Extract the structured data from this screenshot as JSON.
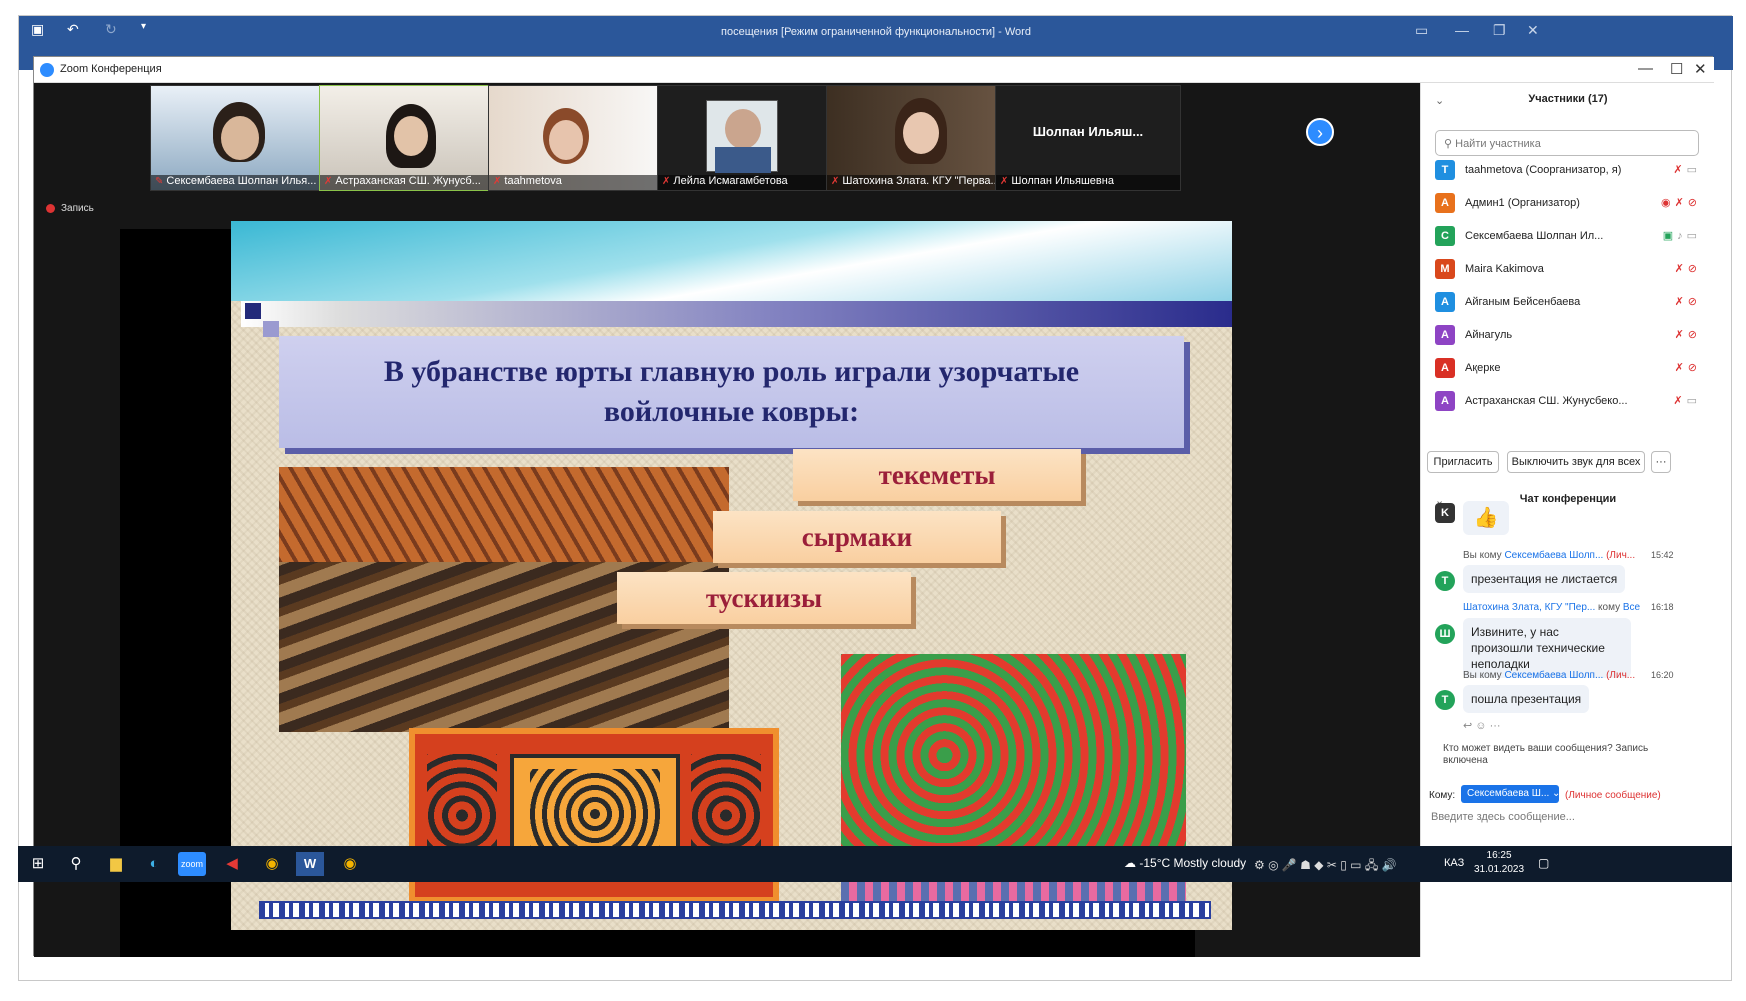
{
  "word": {
    "title": "посещения [Режим ограниченной функциональности] - Word"
  },
  "zoom": {
    "window_title": "Zoom Конференция",
    "recording": "Запись"
  },
  "video_tiles": [
    {
      "name": "Сексембаева Шолпан Илья...",
      "bg": "#8aa7c0"
    },
    {
      "name": "Астраханская СШ. Жунусб...",
      "bg": "#c9c2b8"
    },
    {
      "name": "taahmetova",
      "bg": "#d8cfc6"
    },
    {
      "name": "Лейла Исмагамбетова",
      "bg": "#2a2a2a"
    },
    {
      "name": "Шатохина Злата. КГУ \"Перва...",
      "bg": "#5a4a3a"
    },
    {
      "name": "Шолпан Ильяшевна",
      "bg": "#1e1e1e",
      "label": "Шолпан  Ильяш..."
    }
  ],
  "slide": {
    "heading": "В убранстве юрты главную роль играли узорчатые войлочные ковры:",
    "labels": [
      "текеметы",
      "сырмаки",
      "тускиизы"
    ]
  },
  "participants": {
    "title": "Участники (17)",
    "search_placeholder": "Найти участника",
    "list": [
      {
        "initial": "T",
        "name": "taahmetova (Соорганизатор, я)",
        "color": "#1f8fe0"
      },
      {
        "initial": "А",
        "name": "Админ1 (Организатор)",
        "color": "#e8711c"
      },
      {
        "initial": "С",
        "name": "Сексембаева Шолпан Ил...",
        "color": "#23a35a"
      },
      {
        "initial": "M",
        "name": "Maira Kakimova",
        "color": "#d9481c"
      },
      {
        "initial": "А",
        "name": "Айганым Бейсенбаева",
        "color": "#1f8fe0"
      },
      {
        "initial": "А",
        "name": "Айнагуль",
        "color": "#8e44c4"
      },
      {
        "initial": "А",
        "name": "Ақерке",
        "color": "#d93025"
      },
      {
        "initial": "А",
        "name": "Астраханская СШ. Жунусбеко...",
        "color": "#8e44c4"
      }
    ],
    "invite": "Пригласить",
    "mute_all": "Выключить звук для всех",
    "more": "···"
  },
  "chat": {
    "title": "Чат конференции",
    "messages": [
      {
        "meta_prefix": "Вы кому",
        "to": "Сексембаева Шолп...",
        "tag": "(Лич...",
        "time": "15:42",
        "text": "презентация не листается"
      },
      {
        "meta_prefix": "Шатохина Злата, КГУ \"Пер...",
        "to_prefix": "кому",
        "to": "Все",
        "time": "16:18",
        "text": "Извините, у нас произошли технические неполадки"
      },
      {
        "meta_prefix": "Вы кому",
        "to": "Сексембаева Шолп...",
        "tag": "(Лич...",
        "time": "16:20",
        "text": "пошла презентация"
      }
    ],
    "who_can_see": "Кто может видеть ваши сообщения? Запись включена",
    "to_label": "Кому:",
    "to_value": "Сексембаева Ш...",
    "private": "(Личное сообщение)",
    "input_placeholder": "Введите здесь сообщение..."
  },
  "taskbar": {
    "weather": "-15°C  Mostly cloudy",
    "lang": "КАЗ",
    "time": "16:25",
    "date": "31.01.2023"
  }
}
